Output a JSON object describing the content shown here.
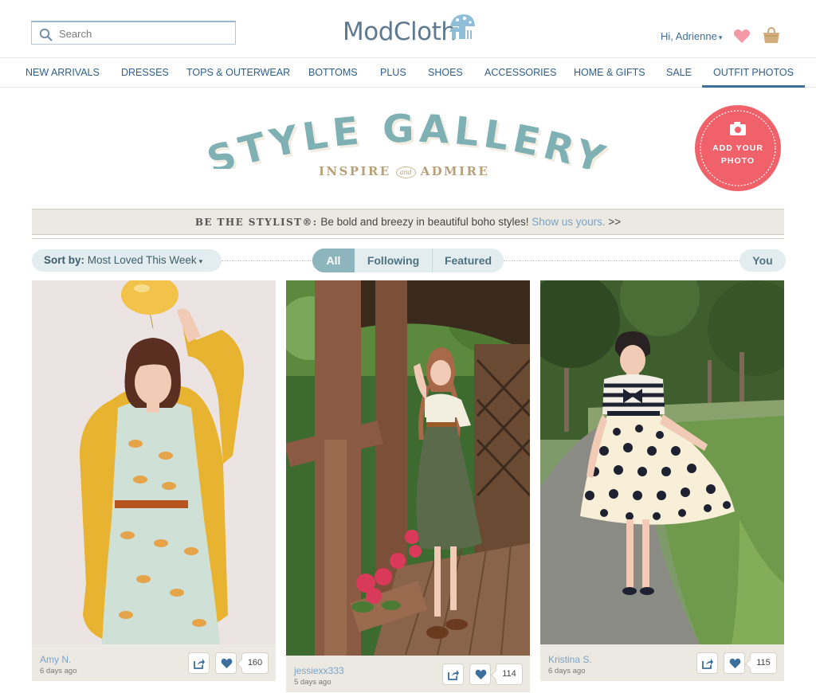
{
  "header": {
    "search_placeholder": "Search",
    "logo_text": "ModCloth",
    "user_greeting": "Hi, Adrienne",
    "caret": "▾"
  },
  "nav": {
    "items": [
      "NEW ARRIVALS",
      "DRESSES",
      "TOPS & OUTERWEAR",
      "BOTTOMS",
      "PLUS",
      "SHOES",
      "ACCESSORIES",
      "HOME & GIFTS",
      "SALE",
      "OUTFIT PHOTOS"
    ],
    "active": "OUTFIT PHOTOS"
  },
  "hero": {
    "title": "STYLE GALLERY",
    "tagline_left": "INSPIRE",
    "tagline_and": "and",
    "tagline_right": "ADMIRE",
    "add_photo_line1": "ADD YOUR",
    "add_photo_line2": "PHOTO"
  },
  "banner": {
    "lead": "BE THE STYLIST®:",
    "text": " Be bold and breezy in beautiful boho styles! ",
    "link": "Show us yours.",
    "arrows": " >>"
  },
  "filters": {
    "sort_label": "Sort by:",
    "sort_value": "Most Loved This Week",
    "tabs": [
      "All",
      "Following",
      "Featured"
    ],
    "active_tab": "All",
    "you": "You"
  },
  "posts": [
    {
      "author": "Amy N.",
      "ago": "6 days ago",
      "likes": "160"
    },
    {
      "author": "jessiexx333",
      "ago": "5 days ago",
      "likes": "114"
    },
    {
      "author": "Kristina S.",
      "ago": "6 days ago",
      "likes": "115"
    }
  ],
  "colors": {
    "brand_blue": "#3c6f9c",
    "title_teal": "#7fb1b4",
    "accent_coral": "#f0616a",
    "tab_active": "#8cb5bd",
    "banner_bg": "#ece9e2"
  }
}
